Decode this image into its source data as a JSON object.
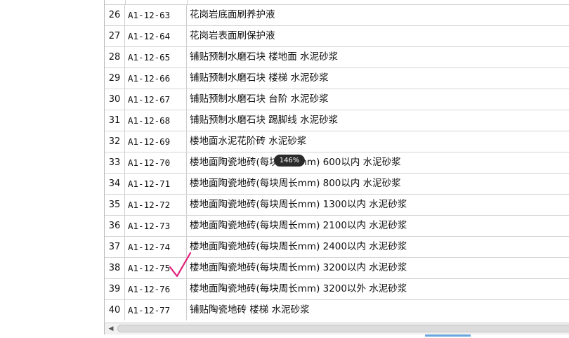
{
  "zoom": "146%",
  "rows": [
    {
      "num": "26",
      "code": "A1-12-63",
      "name": "花岗岩底面刷养护液"
    },
    {
      "num": "27",
      "code": "A1-12-64",
      "name": "花岗岩表面刷保护液"
    },
    {
      "num": "28",
      "code": "A1-12-65",
      "name": "铺贴预制水磨石块 楼地面 水泥砂浆"
    },
    {
      "num": "29",
      "code": "A1-12-66",
      "name": "铺贴预制水磨石块 楼梯 水泥砂浆"
    },
    {
      "num": "30",
      "code": "A1-12-67",
      "name": "铺贴预制水磨石块 台阶 水泥砂浆"
    },
    {
      "num": "31",
      "code": "A1-12-68",
      "name": "铺贴预制水磨石块 踢脚线 水泥砂浆"
    },
    {
      "num": "32",
      "code": "A1-12-69",
      "name": "楼地面水泥花阶砖 水泥砂浆"
    },
    {
      "num": "33",
      "code": "A1-12-70",
      "name": "楼地面陶瓷地砖(每块周长mm) 600以内 水泥砂浆"
    },
    {
      "num": "34",
      "code": "A1-12-71",
      "name": "楼地面陶瓷地砖(每块周长mm) 800以内 水泥砂浆"
    },
    {
      "num": "35",
      "code": "A1-12-72",
      "name": "楼地面陶瓷地砖(每块周长mm) 1300以内 水泥砂浆"
    },
    {
      "num": "36",
      "code": "A1-12-73",
      "name": "楼地面陶瓷地砖(每块周长mm) 2100以内 水泥砂浆"
    },
    {
      "num": "37",
      "code": "A1-12-74",
      "name": "楼地面陶瓷地砖(每块周长mm) 2400以内 水泥砂浆"
    },
    {
      "num": "38",
      "code": "A1-12-75",
      "name": "楼地面陶瓷地砖(每块周长mm) 3200以内 水泥砂浆"
    },
    {
      "num": "39",
      "code": "A1-12-76",
      "name": "楼地面陶瓷地砖(每块周长mm) 3200以外 水泥砂浆"
    },
    {
      "num": "40",
      "code": "A1-12-77",
      "name": "铺贴陶瓷地砖 楼梯 水泥砂浆"
    }
  ],
  "annotation": {
    "icon": "checkmark-icon",
    "color": "#e0207a"
  },
  "colors": {
    "grid_line": "#d6d6d6",
    "scroll_accent": "#6aa7e0"
  }
}
